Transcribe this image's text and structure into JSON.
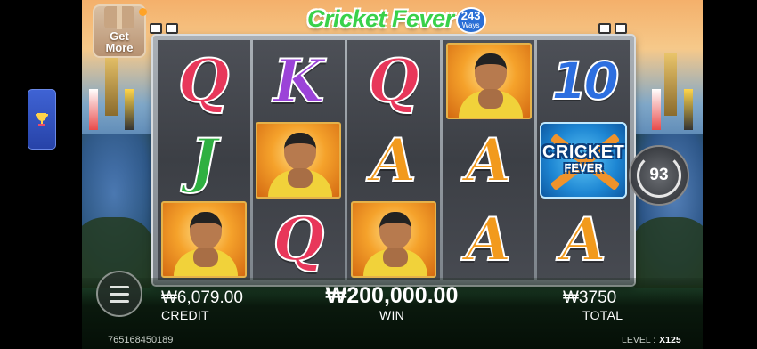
{
  "header": {
    "game_title": "Cricket Fever",
    "ways_number": "243",
    "ways_label": "Ways"
  },
  "promo": {
    "get_more_label": "Get More"
  },
  "reels": [
    [
      {
        "type": "letter",
        "value": "Q",
        "color": "#e8375a"
      },
      {
        "type": "letter",
        "value": "J",
        "color": "#2fb041"
      },
      {
        "type": "player"
      }
    ],
    [
      {
        "type": "letter",
        "value": "K",
        "color": "#9b43d8"
      },
      {
        "type": "player"
      },
      {
        "type": "letter",
        "value": "Q",
        "color": "#e8375a"
      }
    ],
    [
      {
        "type": "letter",
        "value": "Q",
        "color": "#e8375a"
      },
      {
        "type": "letter",
        "value": "A",
        "color": "#f29a1d"
      },
      {
        "type": "player"
      }
    ],
    [
      {
        "type": "player"
      },
      {
        "type": "letter",
        "value": "A",
        "color": "#f29a1d"
      },
      {
        "type": "letter",
        "value": "A",
        "color": "#f29a1d"
      }
    ],
    [
      {
        "type": "letter",
        "value": "10",
        "color": "#2d6fe0"
      },
      {
        "type": "wild",
        "line1": "CRICKET",
        "line2": "FEVER"
      },
      {
        "type": "letter",
        "value": "A",
        "color": "#f29a1d"
      }
    ]
  ],
  "spin_counter": {
    "value": "93"
  },
  "footer": {
    "credit_value": "₩6,079.00",
    "credit_label": "CREDIT",
    "win_value": "₩200,000.00",
    "win_label": "WIN",
    "total_value": "₩3750",
    "total_label": "TOTAL",
    "session_id": "765168450189",
    "level_label": "LEVEL :",
    "level_value": "X125"
  },
  "icons": {
    "side_bar": "trophy-icon",
    "menu": "hamburger-menu-icon",
    "spin": "autospin-icon"
  },
  "colors": {
    "side_bar_bg": "#2f4fc0",
    "logo_green": "#3ad14a",
    "ways_badge": "#2a6fd6"
  }
}
